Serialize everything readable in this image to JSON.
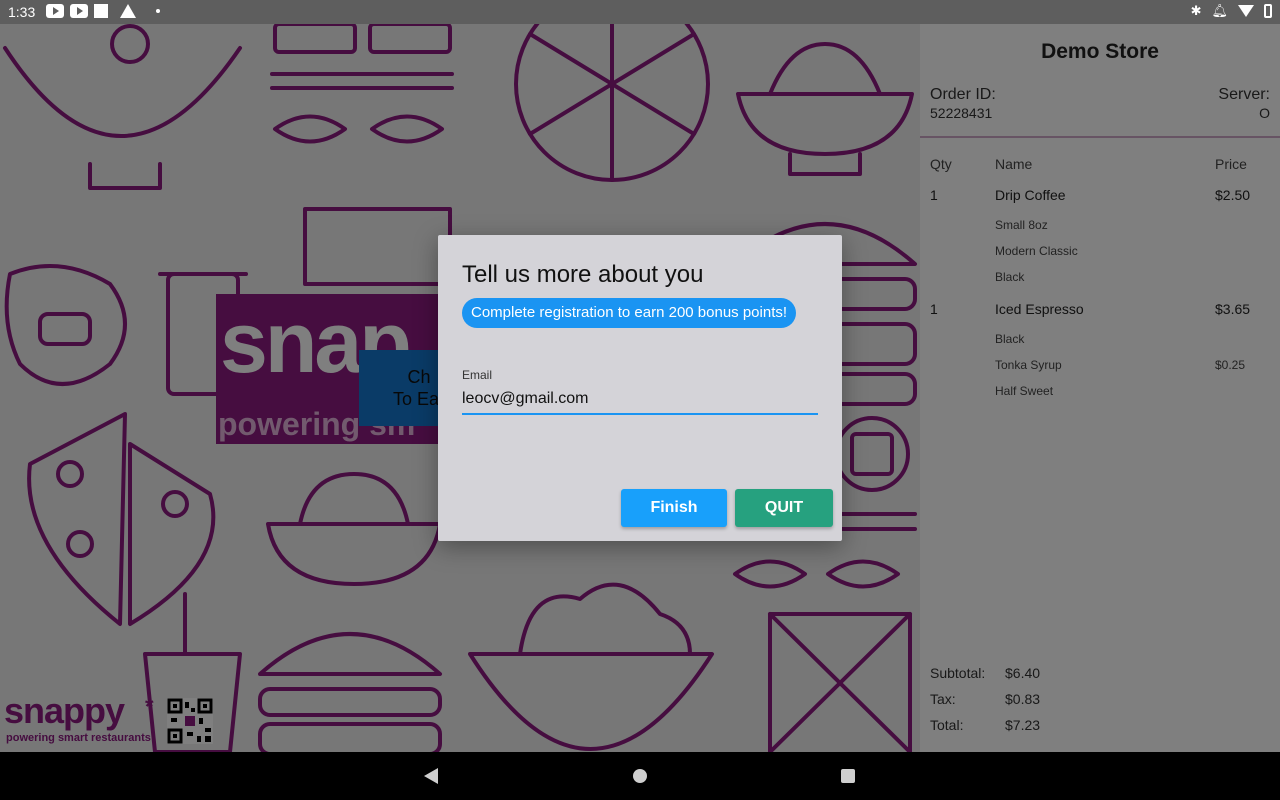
{
  "status_bar": {
    "time": "1:33",
    "left_icons": [
      "youtube-icon",
      "youtube-icon",
      "square-icon",
      "warning-icon",
      "dot-icon"
    ],
    "right_icons": [
      "bluetooth-icon",
      "mute-icon",
      "wifi-icon",
      "battery-icon"
    ]
  },
  "background": {
    "brand_big": "snap",
    "brand_small": "powering sm",
    "check_line1": "Ch",
    "check_line2": "To Ear",
    "logo_word": "snappy",
    "logo_star": "*",
    "logo_tag": "powering smart restaurants"
  },
  "order": {
    "store_name": "Demo Store",
    "order_id_label": "Order ID:",
    "order_id": "52228431",
    "server_label": "Server:",
    "server": "O",
    "columns": {
      "qty": "Qty",
      "name": "Name",
      "price": "Price"
    },
    "items": [
      {
        "qty": "1",
        "name": "Drip Coffee",
        "price": "$2.50",
        "modifiers": [
          {
            "name": "Small 8oz",
            "price": ""
          },
          {
            "name": "Modern Classic",
            "price": ""
          },
          {
            "name": "Black",
            "price": ""
          }
        ]
      },
      {
        "qty": "1",
        "name": "Iced Espresso",
        "price": "$3.65",
        "modifiers": [
          {
            "name": "Black",
            "price": ""
          },
          {
            "name": "Tonka Syrup",
            "price": "$0.25"
          },
          {
            "name": "Half Sweet",
            "price": ""
          }
        ]
      }
    ],
    "totals": {
      "subtotal_label": "Subtotal:",
      "subtotal": "$6.40",
      "tax_label": "Tax:",
      "tax": "$0.83",
      "total_label": "Total:",
      "total": "$7.23"
    }
  },
  "dialog": {
    "title": "Tell us more about you",
    "promo": "Complete registration to earn 200 bonus points!",
    "email_label": "Email",
    "email_value": "leocv@gmail.com",
    "finish_label": "Finish",
    "quit_label": "QUIT"
  },
  "colors": {
    "brand_purple": "#8c1a80",
    "primary_blue": "#1a94f2",
    "quit_green": "#26a17f"
  },
  "nav_bar": {
    "icons": [
      "back-icon",
      "home-icon",
      "recents-icon"
    ]
  }
}
